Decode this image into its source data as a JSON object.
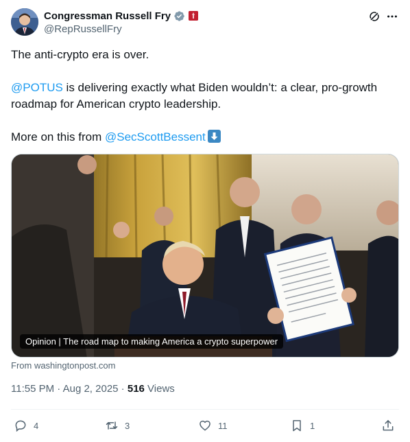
{
  "author": {
    "display_name": "Congressman Russell Fry",
    "handle": "@RepRussellFry",
    "verified_icon": "grey-verified-badge-icon",
    "affiliation_icon": "house-of-representatives-flag-icon"
  },
  "header_actions": {
    "grok_icon": "grok-icon",
    "more_icon": "more-icon"
  },
  "tweet": {
    "line1": "The anti-crypto era is over.",
    "mention1": "@POTUS",
    "line2_rest": " is delivering exactly what Biden wouldn’t: a clear, pro-growth roadmap for American crypto leadership.",
    "line3_prefix": "More on this from ",
    "mention2": "@SecScottBessent",
    "emoji": "down-arrow-emoji"
  },
  "media": {
    "caption": "Opinion | The road map to making America a crypto superpower",
    "source": "From washingtonpost.com"
  },
  "meta": {
    "time": "11:55 PM",
    "separator": " · ",
    "date": "Aug 2, 2025",
    "views_count": "516",
    "views_label": " Views"
  },
  "actions": {
    "replies": "4",
    "reposts": "3",
    "likes": "11",
    "bookmarks": "1"
  },
  "colors": {
    "link": "#1d9bf0",
    "secondary_text": "#536471",
    "primary_text": "#0f1419"
  }
}
